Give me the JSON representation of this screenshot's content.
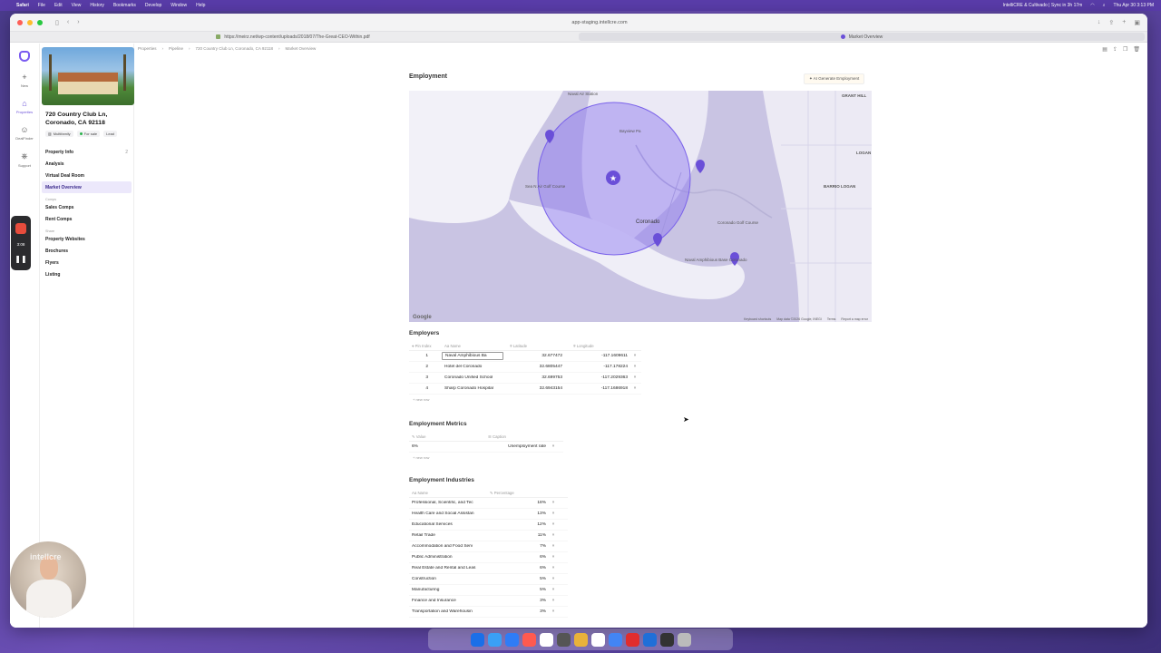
{
  "menubar": {
    "app": "Safari",
    "items": [
      "File",
      "Edit",
      "View",
      "History",
      "Bookmarks",
      "Develop",
      "Window",
      "Help"
    ],
    "sync_status": "IntelliCRE & Cultivado | Sync in 3h 17m",
    "clock": "Thu Apr 30  3:13 PM"
  },
  "browser": {
    "address": "app-staging.intellcre.com",
    "tabs": [
      {
        "label": "https://meirz.net/wp-content/uploads/2018/07/The-Great-CEO-Within.pdf",
        "active": false
      },
      {
        "label": "Market Overview",
        "active": true
      }
    ]
  },
  "rail": {
    "items": [
      {
        "icon": "plus-icon",
        "label": "New"
      },
      {
        "icon": "home-icon",
        "label": "Properties"
      },
      {
        "icon": "user-icon",
        "label": "DealFinder"
      },
      {
        "icon": "support-icon",
        "label": "Support"
      }
    ]
  },
  "property": {
    "title_line1": "720 Country Club Ln,",
    "title_line2": "Coronado, CA 92118",
    "type": "Multifamily",
    "status": "For sale",
    "stage": "Lead",
    "nav": [
      {
        "label": "Property Info",
        "count": "2"
      },
      {
        "label": "Analysis",
        "count": ""
      },
      {
        "label": "Virtual Deal Room",
        "count": ""
      },
      {
        "label": "Market Overview",
        "count": ""
      }
    ],
    "comps_group": "Comps",
    "comps": [
      "Sales Comps",
      "Rent Comps"
    ],
    "share_group": "Share",
    "share": [
      "Property Websites",
      "Brochures",
      "Flyers",
      "Listing"
    ]
  },
  "breadcrumb": [
    "Properties",
    "Pipeline",
    "720 Country Club Ln, Coronado, CA 92118",
    "Market Overview"
  ],
  "employment": {
    "title": "Employment",
    "ai_button": "AI Generate Employment"
  },
  "map": {
    "labels": [
      "Naval Air Station",
      "Bayview Pa",
      "Sea N Air Golf Course",
      "Coronado",
      "Coronado Golf Course",
      "Naval Amphibious Base Coronado",
      "BARRIO LOGAN",
      "GRANT HILL",
      "LOGAN"
    ],
    "footer": [
      "Keyboard shortcuts",
      "Map data ©2026 Google, INEGI",
      "Terms",
      "Report a map error"
    ],
    "google": "Google"
  },
  "employers": {
    "title": "Employers",
    "columns": [
      "Pin Index",
      "Name",
      "Latitude",
      "Longitude"
    ],
    "rows": [
      {
        "idx": "1",
        "name": "Naval Amphibious Ba",
        "lat": "32.677472",
        "lng": "-117.1609611"
      },
      {
        "idx": "2",
        "name": "Hotel del Coronado",
        "lat": "32.6805447",
        "lng": "-117.178224"
      },
      {
        "idx": "3",
        "name": "Coronado Unified School",
        "lat": "32.699753",
        "lng": "-117.2029363"
      },
      {
        "idx": "4",
        "name": "Sharp Coronado Hospital",
        "lat": "32.6943154",
        "lng": "-117.1686918"
      }
    ],
    "new_row": "+ new row"
  },
  "metrics": {
    "title": "Employment Metrics",
    "columns": [
      "Value",
      "Caption"
    ],
    "rows": [
      {
        "value": "6%",
        "caption": "Unemployment rate"
      }
    ],
    "new_row": "+ new row"
  },
  "industries": {
    "title": "Employment Industries",
    "columns": [
      "Name",
      "Percentage"
    ],
    "rows": [
      {
        "name": "Professional, Scientific, and Tec",
        "pct": "18%"
      },
      {
        "name": "Health Care and Social Assistan",
        "pct": "13%"
      },
      {
        "name": "Educational Services",
        "pct": "12%"
      },
      {
        "name": "Retail Trade",
        "pct": "11%"
      },
      {
        "name": "Accommodation and Food Serv",
        "pct": "7%"
      },
      {
        "name": "Public Administration",
        "pct": "6%"
      },
      {
        "name": "Real Estate and Rental and Leas",
        "pct": "6%"
      },
      {
        "name": "Construction",
        "pct": "5%"
      },
      {
        "name": "Manufacturing",
        "pct": "5%"
      },
      {
        "name": "Finance and Insurance",
        "pct": "3%"
      },
      {
        "name": "Transportation and Warehousin",
        "pct": "3%"
      }
    ]
  },
  "recorder": {
    "time": "3:08"
  },
  "webcam": {
    "watermark": "intellcre"
  },
  "dock": {
    "colors": [
      "#1b6fe8",
      "#3aa0f5",
      "#2f7cf6",
      "#ff5a4f",
      "#ffffff",
      "#555555",
      "#e8b23a",
      "#ffffff",
      "#4285f4",
      "#e02d2d",
      "#1f6fd8",
      "#333333",
      "#bbbbbb"
    ]
  }
}
